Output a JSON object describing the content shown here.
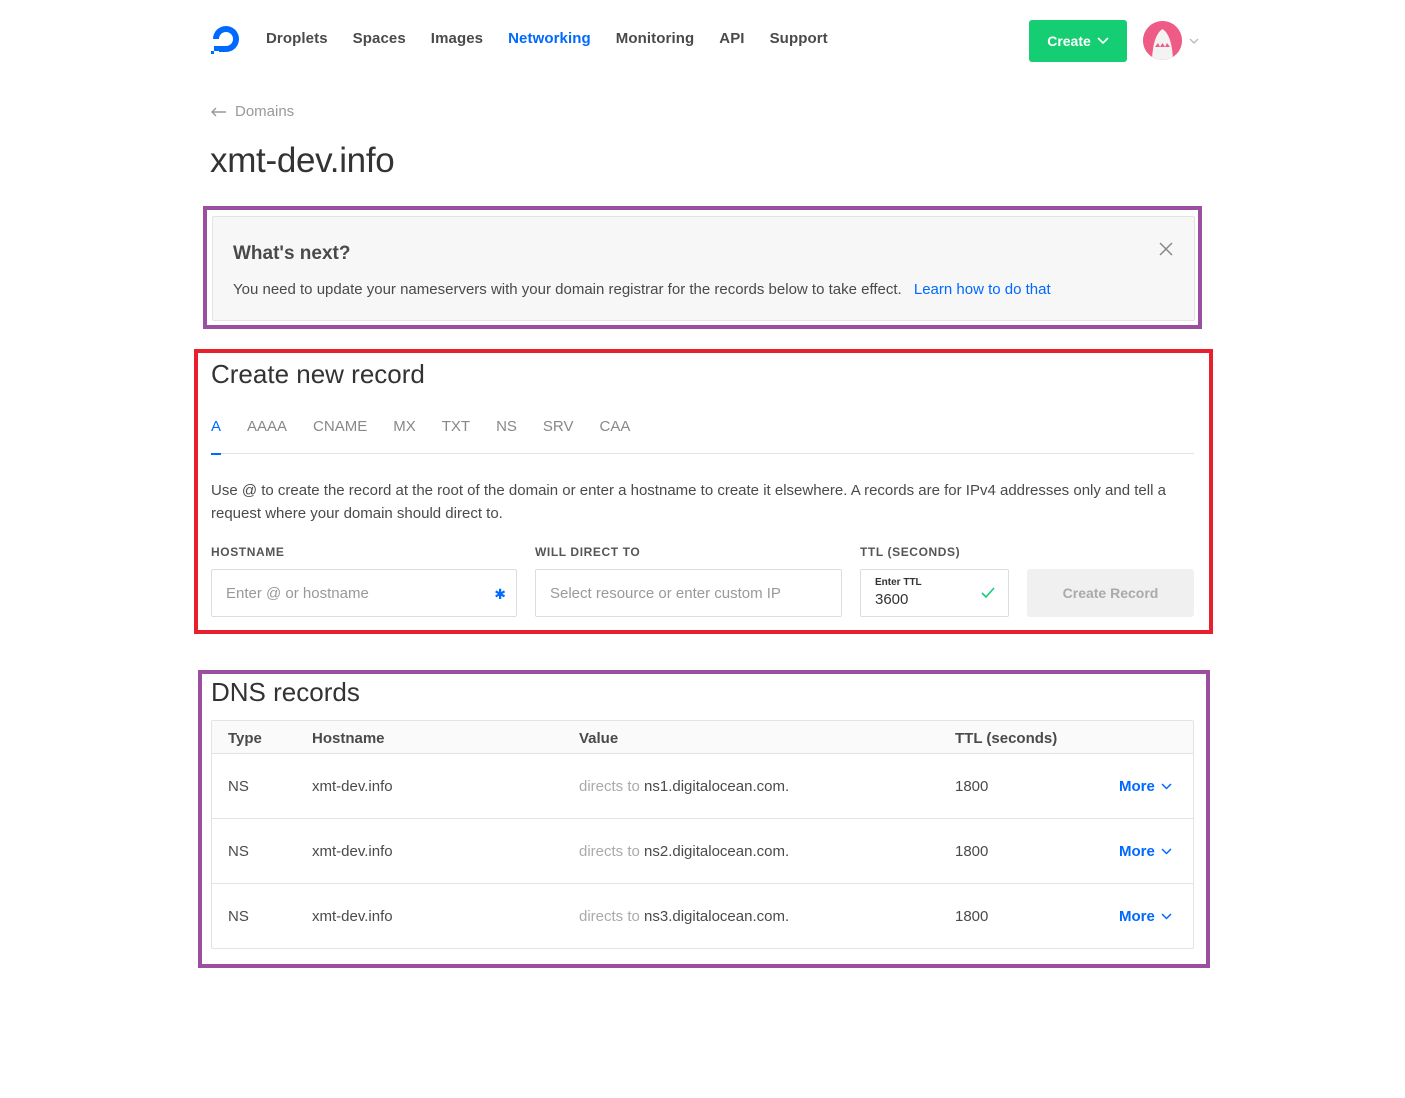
{
  "nav": {
    "links": [
      "Droplets",
      "Spaces",
      "Images",
      "Networking",
      "Monitoring",
      "API",
      "Support"
    ],
    "active": "Networking",
    "create_label": "Create"
  },
  "breadcrumb": {
    "label": "Domains"
  },
  "page_title": "xmt-dev.info",
  "whats_next": {
    "title": "What's next?",
    "text": "You need to update your nameservers with your domain registrar for the records below to take effect.",
    "link": "Learn how to do that"
  },
  "create_record": {
    "title": "Create new record",
    "tabs": [
      "A",
      "AAAA",
      "CNAME",
      "MX",
      "TXT",
      "NS",
      "SRV",
      "CAA"
    ],
    "active_tab": "A",
    "help_text": "Use @ to create the record at the root of the domain or enter a hostname to create it elsewhere. A records are for IPv4 addresses only and tell a request where your domain should direct to.",
    "hostname_label": "HOSTNAME",
    "hostname_placeholder": "Enter @ or hostname",
    "direct_label": "WILL DIRECT TO",
    "direct_placeholder": "Select resource or enter custom IP",
    "ttl_label": "TTL (SECONDS)",
    "ttl_small_label": "Enter TTL",
    "ttl_value": "3600",
    "submit_label": "Create Record"
  },
  "dns_records": {
    "title": "DNS records",
    "columns": [
      "Type",
      "Hostname",
      "Value",
      "TTL (seconds)"
    ],
    "directs_prefix": "directs to",
    "more_label": "More",
    "rows": [
      {
        "type": "NS",
        "hostname": "xmt-dev.info",
        "value": "ns1.digitalocean.com.",
        "ttl": "1800"
      },
      {
        "type": "NS",
        "hostname": "xmt-dev.info",
        "value": "ns2.digitalocean.com.",
        "ttl": "1800"
      },
      {
        "type": "NS",
        "hostname": "xmt-dev.info",
        "value": "ns3.digitalocean.com.",
        "ttl": "1800"
      }
    ]
  },
  "colors": {
    "accent": "#0069ff",
    "create_green": "#15cd72",
    "highlight_purple": "#9b4f9f",
    "highlight_red": "#e8202e"
  }
}
